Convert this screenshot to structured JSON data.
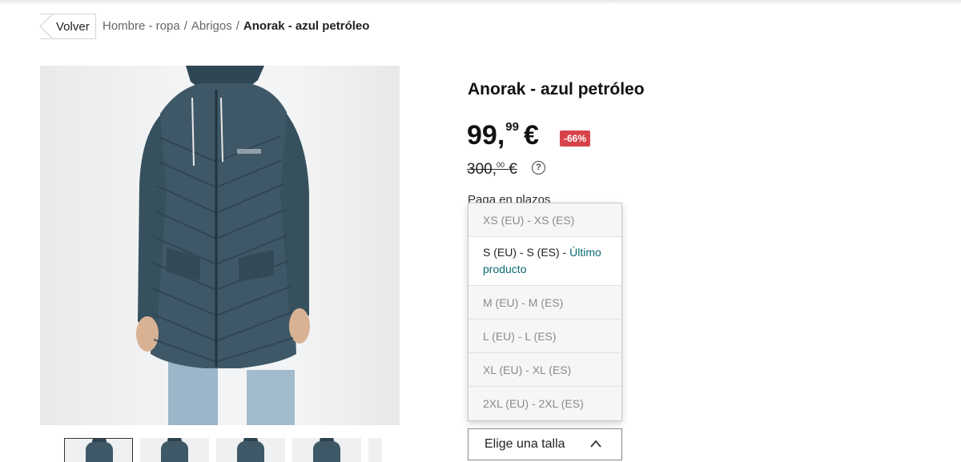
{
  "nav": {
    "back_label": "Volver",
    "breadcrumb": [
      "Hombre - ropa",
      "Abrigos",
      "Anorak - azul petróleo"
    ],
    "separator": "/"
  },
  "product": {
    "title": "Anorak - azul petróleo",
    "price_int": "99,",
    "price_dec": "99",
    "currency": "€",
    "discount_badge": "-66%",
    "old_price_int": "300,",
    "old_price_dec": "00",
    "old_currency": "€",
    "info_icon_glyph": "?",
    "installments_label": "Paga en plazos"
  },
  "sizes": {
    "options": [
      {
        "label": "XS (EU) - XS (ES)",
        "available": false,
        "note": ""
      },
      {
        "label": "S (EU) - S (ES) - ",
        "available": true,
        "note": "Último producto"
      },
      {
        "label": "M (EU) - M (ES)",
        "available": false,
        "note": ""
      },
      {
        "label": "L (EU) - L (ES)",
        "available": false,
        "note": ""
      },
      {
        "label": "XL (EU) - XL (ES)",
        "available": false,
        "note": ""
      },
      {
        "label": "2XL (EU) - 2XL (ES)",
        "available": false,
        "note": ""
      }
    ],
    "select_label": "Elige una talla"
  },
  "colors": {
    "discount": "#d8434a",
    "stock_note": "#0a6b74",
    "coat": "#3f5867"
  },
  "icons": {
    "back": "chevron-left-icon",
    "info": "question-circle-icon",
    "select": "chevron-up-icon"
  }
}
